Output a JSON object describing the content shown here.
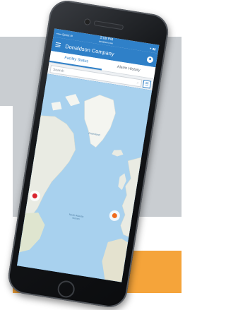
{
  "colors": {
    "brand_blue": "#2f80c8",
    "marker_red": "#d9232e",
    "marker_orange": "#f06a1b",
    "background_grey": "#c9cdd1",
    "accent_orange": "#f5a43a",
    "map_water": "#a8d1ee",
    "map_land": "#e9ebe3"
  },
  "statusbar": {
    "carrier": "••••• Sprint ✉",
    "time": "2:08 PM",
    "url": "donaldson.com",
    "battery": "⁕ ▮▮"
  },
  "appbar": {
    "title": "Donaldson Company",
    "menu_icon": "hamburger-icon",
    "user_icon": "account-icon"
  },
  "tabs": [
    {
      "label": "Facility Status",
      "active": true
    },
    {
      "label": "Alarm History",
      "active": false
    }
  ],
  "search": {
    "placeholder": "Search",
    "icon": "search-icon"
  },
  "view_toggle": {
    "list_icon": "list-icon",
    "map_icon": "map-icon",
    "list_glyph": "☰",
    "map_glyph": "⛰",
    "active": "map"
  },
  "map": {
    "labels": {
      "greenland": "Greenland",
      "north_atlantic": "North Atlantic Ocean"
    },
    "markers": [
      {
        "name": "marker-north-america",
        "status": "alarm",
        "color": "#d9232e"
      },
      {
        "name": "marker-europe",
        "status": "warning",
        "color": "#f06a1b"
      }
    ]
  }
}
